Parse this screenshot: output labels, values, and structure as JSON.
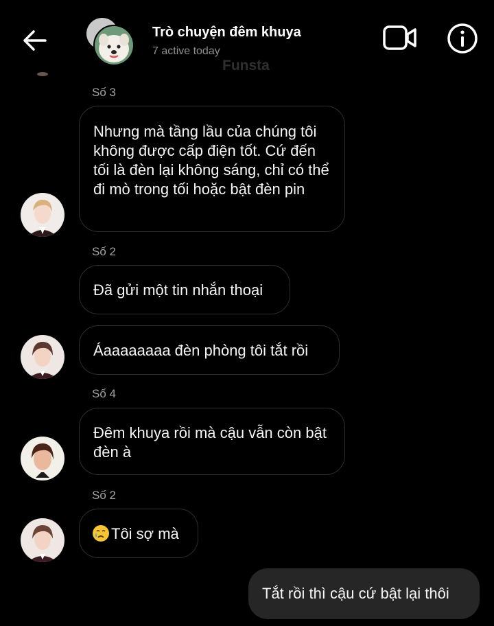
{
  "header": {
    "title": "Trò chuyện đêm khuya",
    "subtitle": "7 active today",
    "back_icon": "arrow-left-icon",
    "video_icon": "video-camera-icon",
    "info_icon": "info-icon"
  },
  "watermark": "Funsta",
  "messages": [
    {
      "sender": "Số 3",
      "text": "Nhưng mà tầng lầu của chúng tôi không được cấp điện tốt. Cứ đến tối là đèn lại không sáng, chỉ có thể đi mò trong tối hoặc bật đèn pin"
    },
    {
      "sender": "Số 2",
      "text": "Đã gửi một tin nhắn thoại"
    },
    {
      "text": "Áaaaaaaaa đèn phòng tôi tắt rồi"
    },
    {
      "sender": "Số 4",
      "text": "Đêm khuya rồi mà cậu vẫn còn bật đèn à"
    },
    {
      "sender": "Số 2",
      "emoji": "crying-face-icon",
      "text": "Tôi sợ mà"
    }
  ],
  "my_message": {
    "text": "Tắt rồi thì cậu cứ bật lại thôi"
  },
  "colors": {
    "background": "#000000",
    "bubble_border": "#2e2e2e",
    "my_bubble": "#262626",
    "muted_text": "#8e8e8e"
  }
}
